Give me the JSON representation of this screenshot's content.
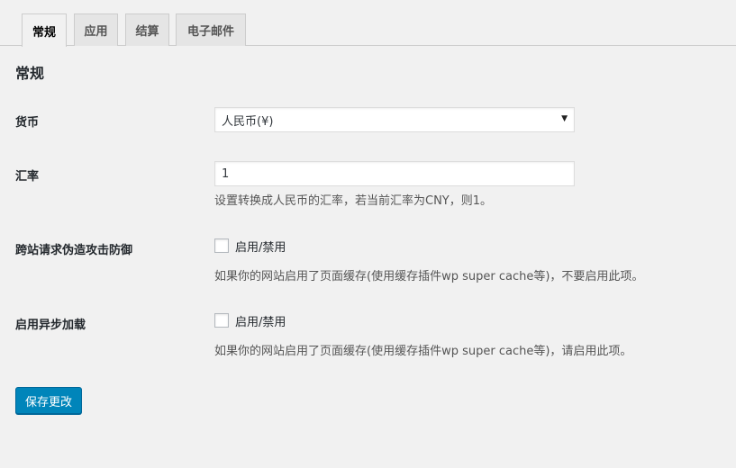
{
  "tabs": [
    {
      "label": "常规",
      "active": true
    },
    {
      "label": "应用",
      "active": false
    },
    {
      "label": "结算",
      "active": false
    },
    {
      "label": "电子邮件",
      "active": false
    }
  ],
  "section": {
    "title": "常规"
  },
  "currency": {
    "label": "货币",
    "selected": "人民币(¥)"
  },
  "rate": {
    "label": "汇率",
    "value": "1",
    "description": "设置转换成人民币的汇率，若当前汇率为CNY，则1。"
  },
  "csrf": {
    "label": "跨站请求伪造攻击防御",
    "checkbox_label": "启用/禁用",
    "checked": false,
    "description": "如果你的网站启用了页面缓存(使用缓存插件wp super cache等)，不要启用此项。"
  },
  "async": {
    "label": "启用异步加载",
    "checkbox_label": "启用/禁用",
    "checked": false,
    "description": "如果你的网站启用了页面缓存(使用缓存插件wp super cache等)，请启用此项。"
  },
  "save_button": {
    "label": "保存更改"
  },
  "colors": {
    "background": "#f1f1f1",
    "primary_button": "#0085ba"
  }
}
